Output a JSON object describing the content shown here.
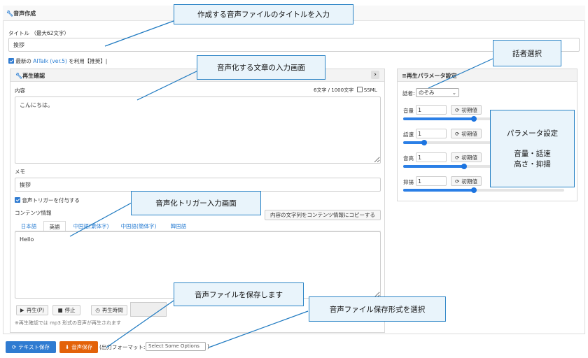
{
  "header": {
    "title": "音声作成"
  },
  "title_field": {
    "label": "タイトル （最大62文字）",
    "value": "挨拶"
  },
  "latest_option": {
    "prefix": "最新の ",
    "link": "AITalk (ver.5)",
    "suffix": " を利用【推奨】|"
  },
  "playback": {
    "title": "再生確認",
    "content_label": "内容",
    "char_count": "6文字 / 1000文字",
    "ssml_label": "SSML",
    "content_value": "こんにちは。",
    "memo_label": "メモ",
    "memo_value": "挨拶",
    "trigger_label": "音声トリガーを付与する",
    "content_info_label": "コンテンツ情報",
    "copy_button": "内容の文字列をコンテンツ情報にコピーする",
    "tabs": [
      "日本語",
      "英語",
      "中国語(繁体字)",
      "中国語(簡体字)",
      "韓国語"
    ],
    "trigger_value": "Hello",
    "play_button": "再生(P)",
    "stop_button": "停止",
    "time_label": "再生時間",
    "note": "※再生確認では mp3 形式の音声が再生されます"
  },
  "params": {
    "title": "再生パラメータ設定",
    "speaker_label": "話者:",
    "speaker_value": "のぞみ",
    "reset_label": "初期値",
    "rows": [
      {
        "label": "音量",
        "value": "1",
        "level": 0.44
      },
      {
        "label": "話速",
        "value": "1",
        "level": 0.13
      },
      {
        "label": "音高",
        "value": "1",
        "level": 0.38
      },
      {
        "label": "抑揚",
        "value": "1",
        "level": 0.44
      }
    ]
  },
  "footer": {
    "text_save": "テキスト保存",
    "audio_save": "音声保存",
    "format_prefix": "(出力フォーマット:",
    "format_placeholder": "Select Some Options",
    "format_suffix": ")"
  },
  "callouts": {
    "title_input": "作成する音声ファイルのタイトルを入力",
    "speaker_select": "話者選択",
    "text_input": "音声化する文章の入力画面",
    "params_line1": "パラメータ設定",
    "params_line2": "音量・話速",
    "params_line3": "高さ・抑揚",
    "trigger_input": "音声化トリガー入力画面",
    "save_audio": "音声ファイルを保存します",
    "format_select": "音声ファイル保存形式を選択"
  },
  "colors": {
    "accent": "#2a7ed3",
    "save_orange": "#e36209",
    "callout_border": "#2b84c6",
    "callout_bg": "#e9f4fb"
  }
}
